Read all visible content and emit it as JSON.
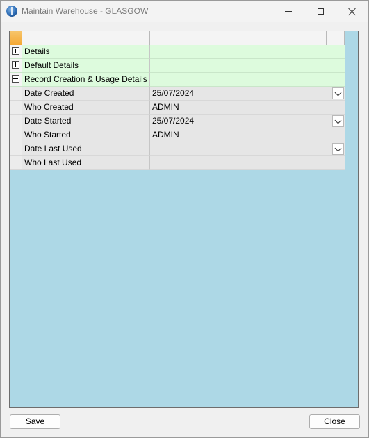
{
  "window": {
    "title": "Maintain Warehouse - GLASGOW"
  },
  "grid": {
    "groups": [
      {
        "label": "Details",
        "state": "collapsed"
      },
      {
        "label": "Default Details",
        "state": "collapsed"
      },
      {
        "label": "Record Creation & Usage Details",
        "state": "expanded"
      }
    ],
    "fields": [
      {
        "label": "Date Created",
        "value": "25/07/2024",
        "has_dropdown": true
      },
      {
        "label": "Who Created",
        "value": "ADMIN",
        "has_dropdown": false
      },
      {
        "label": "Date Started",
        "value": "25/07/2024",
        "has_dropdown": true
      },
      {
        "label": "Who Started",
        "value": "ADMIN",
        "has_dropdown": false
      },
      {
        "label": "Date Last Used",
        "value": "",
        "has_dropdown": true
      },
      {
        "label": "Who Last Used",
        "value": "",
        "has_dropdown": false
      }
    ]
  },
  "buttons": {
    "save": "Save",
    "close": "Close"
  },
  "colors": {
    "grid_background": "#add8e6",
    "group_row": "#ddfbdd",
    "header_corner": "#f4a732"
  }
}
